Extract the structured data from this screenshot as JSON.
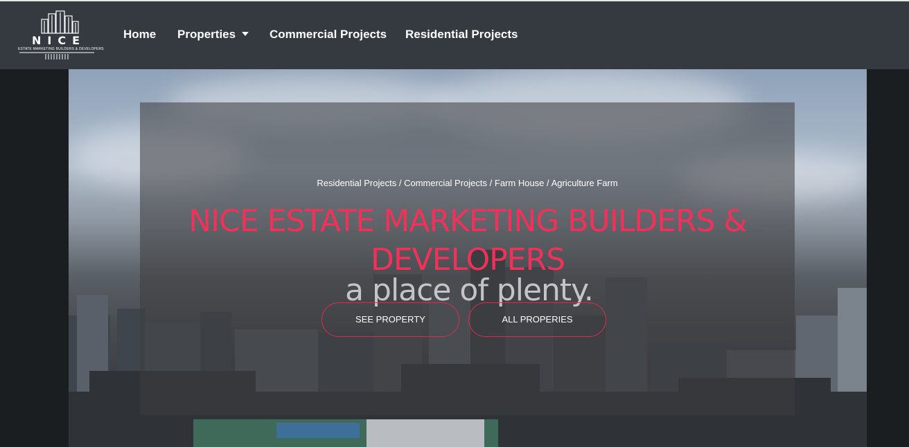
{
  "brand": {
    "name": "NICE",
    "tagline": "ESTATE MARKETING BUILDERS & DEVELOPERS"
  },
  "nav": {
    "items": [
      {
        "label": "Home"
      },
      {
        "label": "Properties",
        "has_dropdown": true
      },
      {
        "label": "Commercial Projects"
      },
      {
        "label": "Residential Projects"
      }
    ]
  },
  "hero": {
    "breadcrumbs": [
      "Residential Projects",
      "Commercial Projects",
      "Farm House",
      "Agriculture Farm"
    ],
    "separator": "/",
    "title": "NICE ESTATE MARKETING BUILDERS & DEVELOPERS",
    "background_tagline": "a place of plenty.",
    "buttons": {
      "see_property": "SEE PROPERTY",
      "all_properties": "ALL PROPERIES"
    }
  },
  "colors": {
    "navbar": "#343a40",
    "accent": "#f0325a",
    "button_border": "#e02a4c",
    "page_bg": "#1b1e20"
  }
}
